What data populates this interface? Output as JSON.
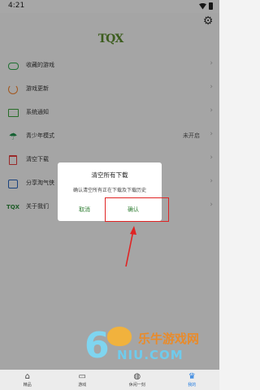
{
  "status": {
    "time": "4:21"
  },
  "logo": {
    "text": "TQX"
  },
  "menu": [
    {
      "label": "收藏的游戏",
      "value": "",
      "icon": "gamepad-icon"
    },
    {
      "label": "游戏更新",
      "value": "",
      "icon": "refresh-icon"
    },
    {
      "label": "系统通知",
      "value": "",
      "icon": "notice-icon"
    },
    {
      "label": "青少年模式",
      "value": "未开启",
      "icon": "umbrella-icon"
    },
    {
      "label": "清空下载",
      "value": "",
      "icon": "trash-icon"
    },
    {
      "label": "分享淘气侠",
      "value": "",
      "icon": "share-icon"
    },
    {
      "label": "关于我们",
      "value": "",
      "icon": "tqx-icon"
    }
  ],
  "dialog": {
    "title": "清空所有下载",
    "message": "确认清空所有正在下载及下载历史",
    "cancel": "取消",
    "confirm": "确认"
  },
  "bottom_nav": [
    {
      "label": "精品",
      "icon": "home-icon"
    },
    {
      "label": "游戏",
      "icon": "gamepad-icon"
    },
    {
      "label": "休闲一刻",
      "icon": "ball-icon"
    },
    {
      "label": "我的",
      "icon": "trophy-icon"
    }
  ],
  "watermark": {
    "name": "乐牛游戏网",
    "domain": "NIU.COM"
  },
  "colors": {
    "accent": "#1f7ae0",
    "dialog_button": "#2e7d32",
    "highlight": "#e02424"
  }
}
